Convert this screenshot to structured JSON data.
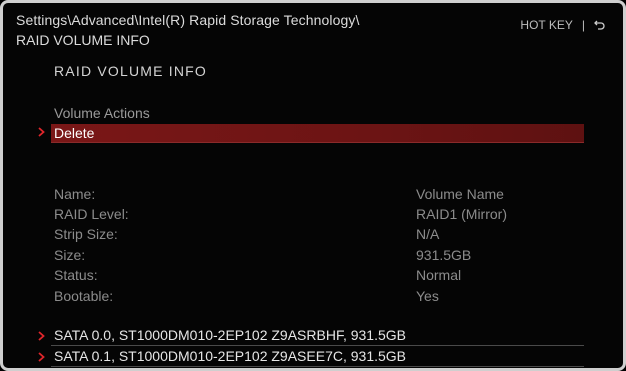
{
  "header": {
    "path": "Settings\\Advanced\\Intel(R) Rapid Storage Technology\\",
    "title": "RAID VOLUME INFO",
    "hotkey_label": "HOT KEY",
    "separator": "|"
  },
  "main": {
    "section_title": "RAID VOLUME INFO",
    "group_label": "Volume Actions",
    "action_delete": "Delete",
    "info": [
      {
        "label": "Name:",
        "value": "Volume Name"
      },
      {
        "label": "RAID Level:",
        "value": "RAID1 (Mirror)"
      },
      {
        "label": "Strip Size:",
        "value": "N/A"
      },
      {
        "label": "Size:",
        "value": "931.5GB"
      },
      {
        "label": "Status:",
        "value": "Normal"
      },
      {
        "label": "Bootable:",
        "value": "Yes"
      }
    ],
    "disks": [
      "SATA 0.0, ST1000DM010-2EP102 Z9ASRBHF, 931.5GB",
      "SATA 0.1, ST1000DM010-2EP102 Z9ASEE7C, 931.5GB"
    ]
  },
  "colors": {
    "accent": "#e0262b",
    "selected_bg": "#6c1414",
    "text_dim": "#8c8c8c"
  },
  "icons": {
    "back": "return-arrow-icon",
    "chevron": "chevron-right-icon"
  }
}
